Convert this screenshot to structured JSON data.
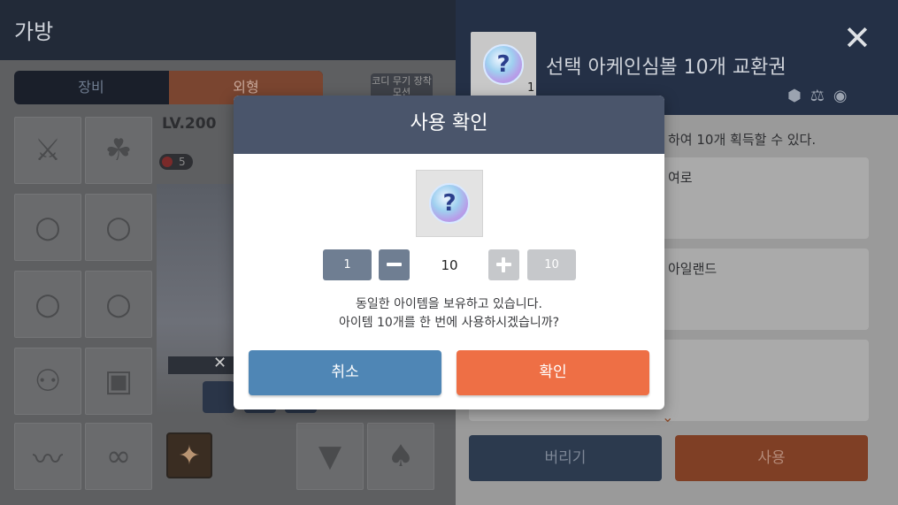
{
  "header": {
    "title": "가방"
  },
  "inventory": {
    "tabs": [
      {
        "label": "장비"
      },
      {
        "label": "외형"
      }
    ],
    "codi_button": "코디 무기 장착 모션",
    "level": "LV.200",
    "star_count": "5"
  },
  "detail": {
    "item_name": "선택 아케인심볼 10개 교환권",
    "item_count": "1",
    "description": "하여 10개 획득할 수 있다.",
    "options": [
      "여로",
      "아일랜드",
      ""
    ],
    "discard_button": "버리기",
    "use_button": "사용"
  },
  "modal": {
    "title": "사용 확인",
    "qty_min": "1",
    "qty_value": "10",
    "qty_max": "10",
    "message_line1": "동일한 아이템을 보유하고 있습니다.",
    "message_line2": "아이템 10개를 한 번에 사용하시겠습니까?",
    "cancel": "취소",
    "confirm": "확인"
  },
  "colors": {
    "modal_header": "#4a556b",
    "cancel": "#4f86b5",
    "confirm": "#ee6f45",
    "stepper": "#6f7e92"
  }
}
